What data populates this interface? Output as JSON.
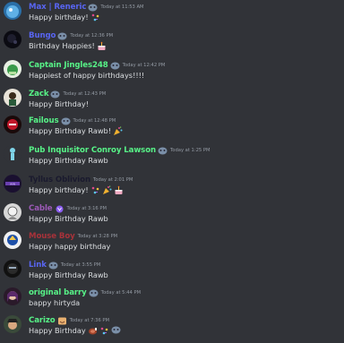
{
  "messages": [
    {
      "author": "Max | Reneric",
      "name_color": "#5865f2",
      "time": "Today at 11:53 AM",
      "text": "Happy birthday!",
      "avatar_icon": "water-avatar",
      "badge": "mood-badge-icon",
      "emojis": [
        "confetti-emoji"
      ]
    },
    {
      "author": "Bungo",
      "name_color": "#5865f2",
      "time": "Today at 12:36 PM",
      "text": "Birthday Happies!",
      "avatar_icon": "dark-avatar",
      "badge": "mood-badge-icon",
      "emojis": [
        "cake-emoji"
      ]
    },
    {
      "author": "Captain Jingles248",
      "name_color": "#57f287",
      "time": "Today at 12:42 PM",
      "text": "Happiest of happy birthdays!!!!",
      "avatar_icon": "green-avatar",
      "badge": "mood-badge-icon",
      "emojis": []
    },
    {
      "author": "Zack",
      "name_color": "#57f287",
      "time": "Today at 12:43 PM",
      "text": "Happy Birthday!",
      "avatar_icon": "character-avatar",
      "badge": "mood-badge-icon",
      "emojis": []
    },
    {
      "author": "Failous",
      "name_color": "#57f287",
      "time": "Today at 12:48 PM",
      "text": "Happy Birthday Rawb!",
      "avatar_icon": "red-mask-avatar",
      "badge": "mood-badge-icon",
      "emojis": [
        "party-popper-emoji"
      ]
    },
    {
      "author": "Pub Inquisitor Conroy Lawson",
      "name_color": "#57f287",
      "time": "Today at 1:25 PM",
      "text": "Happy Birthday Rawb",
      "avatar_icon": "blue-figure-avatar",
      "badge": "mood-badge-icon",
      "emojis": []
    },
    {
      "author": "Tyllus Oblivion",
      "name_color": "#1a1a2e",
      "time": "Today at 2:01 PM",
      "text": "Happy birthday!",
      "avatar_icon": "purple-banner-avatar",
      "badge": "",
      "emojis": [
        "confetti-emoji",
        "party-popper-emoji",
        "cake-emoji"
      ]
    },
    {
      "author": "Cable",
      "name_color": "#9b59b6",
      "time": "Today at 3:16 PM",
      "text": "Happy Birthday Rawb",
      "avatar_icon": "sketch-avatar",
      "badge": "purple-badge-icon",
      "emojis": []
    },
    {
      "author": "Mouse Boy",
      "name_color": "#a8323a",
      "time": "Today at 3:28 PM",
      "text": "Happy happy birthday",
      "avatar_icon": "blue-hero-avatar",
      "badge": "",
      "emojis": []
    },
    {
      "author": "Link",
      "name_color": "#5865f2",
      "time": "Today at 3:55 PM",
      "text": "Happy Birthday Rawb",
      "avatar_icon": "mask-avatar",
      "badge": "mood-badge-icon",
      "emojis": []
    },
    {
      "author": "original barry",
      "name_color": "#57f287",
      "time": "Today at 5:44 PM",
      "text": "bappy hirtyda",
      "avatar_icon": "purple-girl-avatar",
      "badge": "mood-badge-icon",
      "emojis": []
    },
    {
      "author": "Carizo",
      "name_color": "#57f287",
      "time": "Today at 7:36 PM",
      "text": "Happy Birthday",
      "avatar_icon": "pirate-avatar",
      "badge": "smile-badge-icon",
      "emojis": [
        "meat-emoji",
        "confetti-emoji",
        "mood-badge-icon"
      ]
    }
  ]
}
